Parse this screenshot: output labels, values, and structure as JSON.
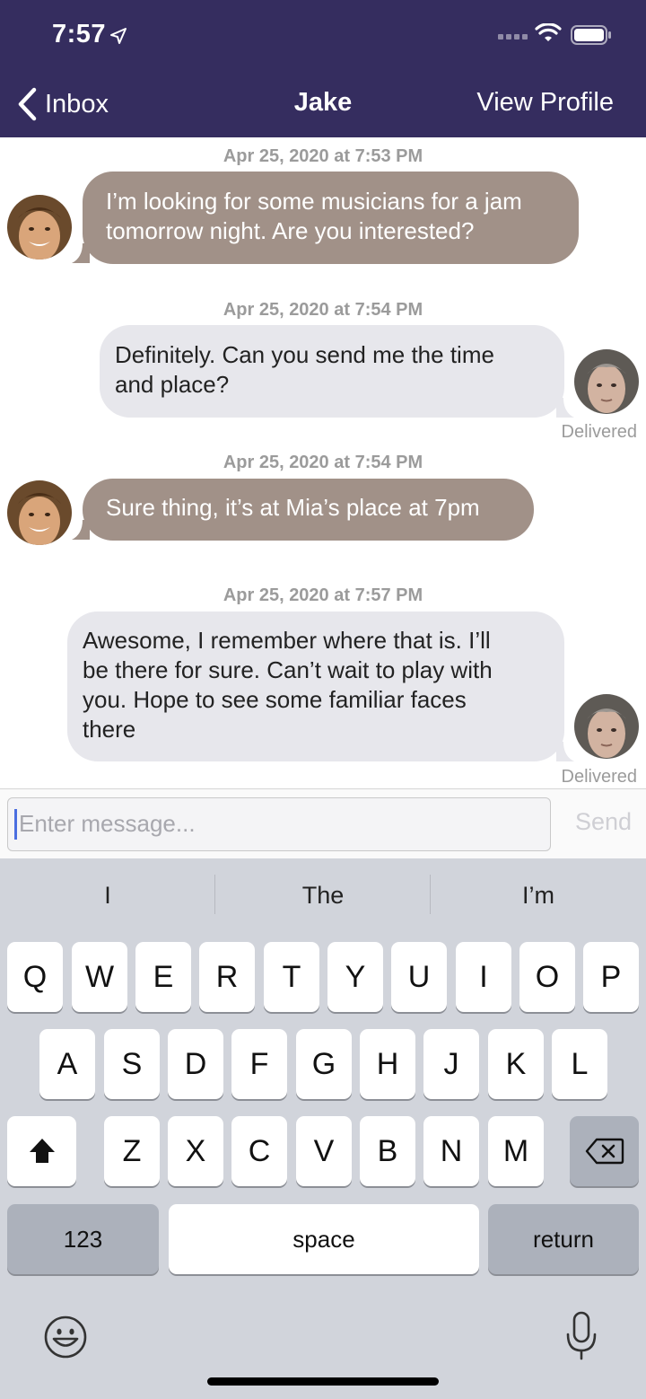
{
  "status_bar": {
    "time": "7:57"
  },
  "nav": {
    "back_label": "Inbox",
    "title": "Jake",
    "right_action": "View Profile"
  },
  "messages": [
    {
      "timestamp": "Apr 25, 2020 at 7:53 PM",
      "direction": "incoming",
      "lines": [
        "I’m looking for some musicians for a jam",
        "tomorrow night. Are you interested?"
      ],
      "status": ""
    },
    {
      "timestamp": "Apr 25, 2020 at 7:54 PM",
      "direction": "outgoing",
      "lines": [
        "Definitely. Can you send me the time",
        "and place?"
      ],
      "status": "Delivered"
    },
    {
      "timestamp": "Apr 25, 2020 at 7:54 PM",
      "direction": "incoming",
      "lines": [
        "Sure thing, it’s at Mia’s place at 7pm"
      ],
      "status": ""
    },
    {
      "timestamp": "Apr 25, 2020 at 7:57 PM",
      "direction": "outgoing",
      "lines": [
        "Awesome, I remember where that is. I’ll",
        "be there for sure. Can’t wait to play with",
        "you. Hope to see some familiar faces",
        "there"
      ],
      "status": "Delivered"
    }
  ],
  "composer": {
    "placeholder": "Enter message...",
    "send_label": "Send"
  },
  "keyboard": {
    "suggestions": [
      "I",
      "The",
      "I’m"
    ],
    "row1": [
      "Q",
      "W",
      "E",
      "R",
      "T",
      "Y",
      "U",
      "I",
      "O",
      "P"
    ],
    "row2": [
      "A",
      "S",
      "D",
      "F",
      "G",
      "H",
      "J",
      "K",
      "L"
    ],
    "row3": [
      "Z",
      "X",
      "C",
      "V",
      "B",
      "N",
      "M"
    ],
    "numbers_label": "123",
    "space_label": "space",
    "return_label": "return"
  },
  "colors": {
    "header_bg": "#352d5f",
    "incoming_bubble": "#a19188",
    "outgoing_bubble": "#e7e7ec",
    "keyboard_bg": "#d1d4db"
  },
  "icons": [
    "location-arrow-icon",
    "signal-icon",
    "wifi-icon",
    "battery-icon",
    "back-chevron-icon",
    "shift-icon",
    "delete-icon",
    "emoji-icon",
    "microphone-icon"
  ]
}
